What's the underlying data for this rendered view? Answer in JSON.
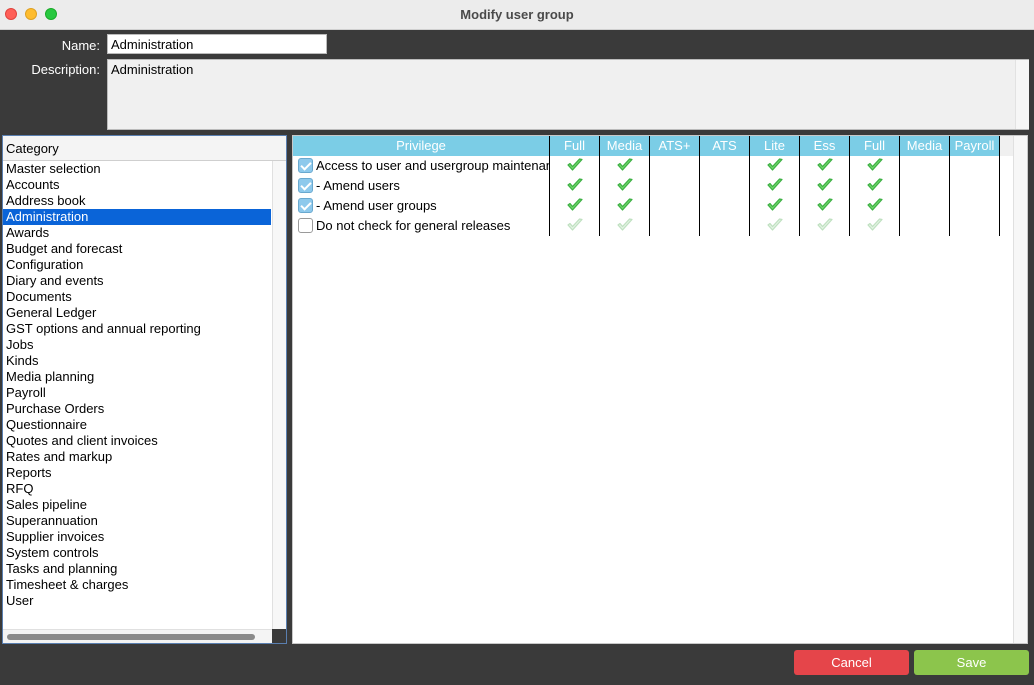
{
  "window": {
    "title": "Modify user group"
  },
  "form": {
    "name_label": "Name:",
    "name_value": "Administration",
    "description_label": "Description:",
    "description_value": "Administration"
  },
  "categories": {
    "header": "Category",
    "selected": "Administration",
    "items": [
      "Master selection",
      "Accounts",
      "Address book",
      "Administration",
      "Awards",
      "Budget and forecast",
      "Configuration",
      "Diary and events",
      "Documents",
      "General Ledger",
      "GST options and annual reporting",
      "Jobs",
      "Kinds",
      "Media planning",
      "Payroll",
      "Purchase Orders",
      "Questionnaire",
      "Quotes and client invoices",
      "Rates and markup",
      "Reports",
      "RFQ",
      "Sales pipeline",
      "Superannuation",
      "Supplier invoices",
      "System controls",
      "Tasks and planning",
      "Timesheet & charges",
      "User"
    ]
  },
  "privileges": {
    "columns": [
      "Privilege",
      "Full",
      "Media",
      "ATS+",
      "ATS",
      "Lite",
      "Ess",
      "Full",
      "Media",
      "Payroll"
    ],
    "rows": [
      {
        "name": "Access to user and usergroup maintenance",
        "enabled": true,
        "marks": [
          "on",
          "on",
          "",
          "",
          "on",
          "on",
          "on",
          "",
          ""
        ]
      },
      {
        "name": " - Amend users",
        "enabled": true,
        "marks": [
          "on",
          "on",
          "",
          "",
          "on",
          "on",
          "on",
          "",
          ""
        ]
      },
      {
        "name": " - Amend user groups",
        "enabled": true,
        "marks": [
          "on",
          "on",
          "",
          "",
          "on",
          "on",
          "on",
          "",
          ""
        ]
      },
      {
        "name": "Do not check for general releases",
        "enabled": false,
        "marks": [
          "dim",
          "dim",
          "",
          "",
          "dim",
          "dim",
          "dim",
          "",
          ""
        ]
      }
    ]
  },
  "buttons": {
    "cancel": "Cancel",
    "save": "Save"
  },
  "colors": {
    "selection": "#0a64d8",
    "header": "#7bcde6",
    "cancel": "#e5454a",
    "save": "#8cc54c",
    "check": "#3cb043"
  },
  "icons": {
    "granted": "green-check-icon",
    "default": "faded-check-icon"
  }
}
